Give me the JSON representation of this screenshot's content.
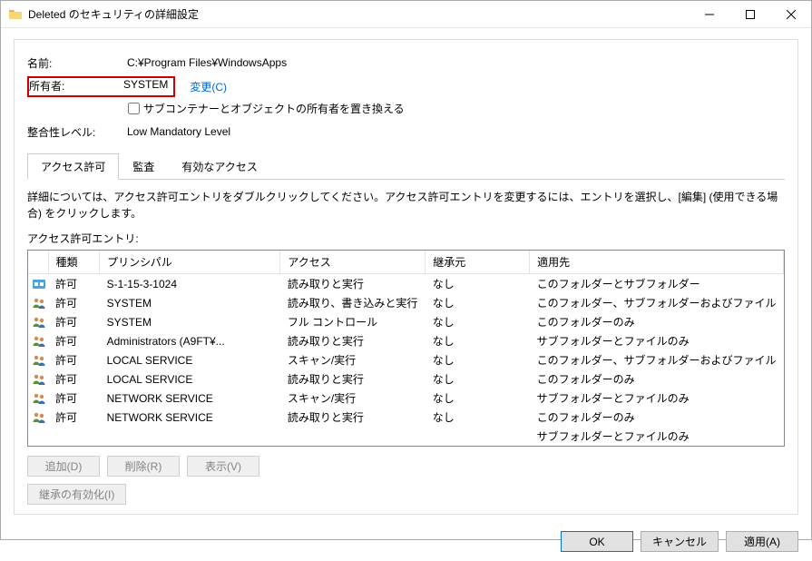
{
  "window": {
    "title": "Deleted のセキュリティの詳細設定"
  },
  "fields": {
    "name_label": "名前:",
    "name_value": "C:¥Program Files¥WindowsApps",
    "owner_label": "所有者:",
    "owner_value": "SYSTEM",
    "change_link": "変更(C)",
    "replace_owner_checkbox": "サブコンテナーとオブジェクトの所有者を置き換える",
    "integrity_label": "整合性レベル:",
    "integrity_value": "Low Mandatory Level"
  },
  "tabs": {
    "permissions": "アクセス許可",
    "auditing": "監査",
    "effective": "有効なアクセス"
  },
  "description": "詳細については、アクセス許可エントリをダブルクリックしてください。アクセス許可エントリを変更するには、エントリを選択し、[編集] (使用できる場合) をクリックします。",
  "entries_label": "アクセス許可エントリ:",
  "columns": {
    "type": "種類",
    "principal": "プリンシパル",
    "access": "アクセス",
    "inherited": "継承元",
    "applies": "適用先"
  },
  "entries": [
    {
      "icon": "group-app",
      "type": "許可",
      "principal": "S-1-15-3-1024",
      "access": "読み取りと実行",
      "inherited": "なし",
      "applies": "このフォルダーとサブフォルダー"
    },
    {
      "icon": "group",
      "type": "許可",
      "principal": "SYSTEM",
      "access": "読み取り、書き込みと実行",
      "inherited": "なし",
      "applies": "このフォルダー、サブフォルダーおよびファイル"
    },
    {
      "icon": "group",
      "type": "許可",
      "principal": "SYSTEM",
      "access": "フル コントロール",
      "inherited": "なし",
      "applies": "このフォルダーのみ"
    },
    {
      "icon": "group",
      "type": "許可",
      "principal": "Administrators (A9FT¥...",
      "access": "読み取りと実行",
      "inherited": "なし",
      "applies": "サブフォルダーとファイルのみ"
    },
    {
      "icon": "group",
      "type": "許可",
      "principal": "LOCAL SERVICE",
      "access": "スキャン/実行",
      "inherited": "なし",
      "applies": "このフォルダー、サブフォルダーおよびファイル"
    },
    {
      "icon": "group",
      "type": "許可",
      "principal": "LOCAL SERVICE",
      "access": "読み取りと実行",
      "inherited": "なし",
      "applies": "このフォルダーのみ"
    },
    {
      "icon": "group",
      "type": "許可",
      "principal": "NETWORK SERVICE",
      "access": "スキャン/実行",
      "inherited": "なし",
      "applies": "サブフォルダーとファイルのみ"
    },
    {
      "icon": "group",
      "type": "許可",
      "principal": "NETWORK SERVICE",
      "access": "読み取りと実行",
      "inherited": "なし",
      "applies": "このフォルダーのみ"
    }
  ],
  "extra_applies": "サブフォルダーとファイルのみ",
  "buttons": {
    "add": "追加(D)",
    "remove": "削除(R)",
    "view": "表示(V)",
    "enable_inherit": "継承の有効化(I)",
    "ok": "OK",
    "cancel": "キャンセル",
    "apply": "適用(A)"
  }
}
